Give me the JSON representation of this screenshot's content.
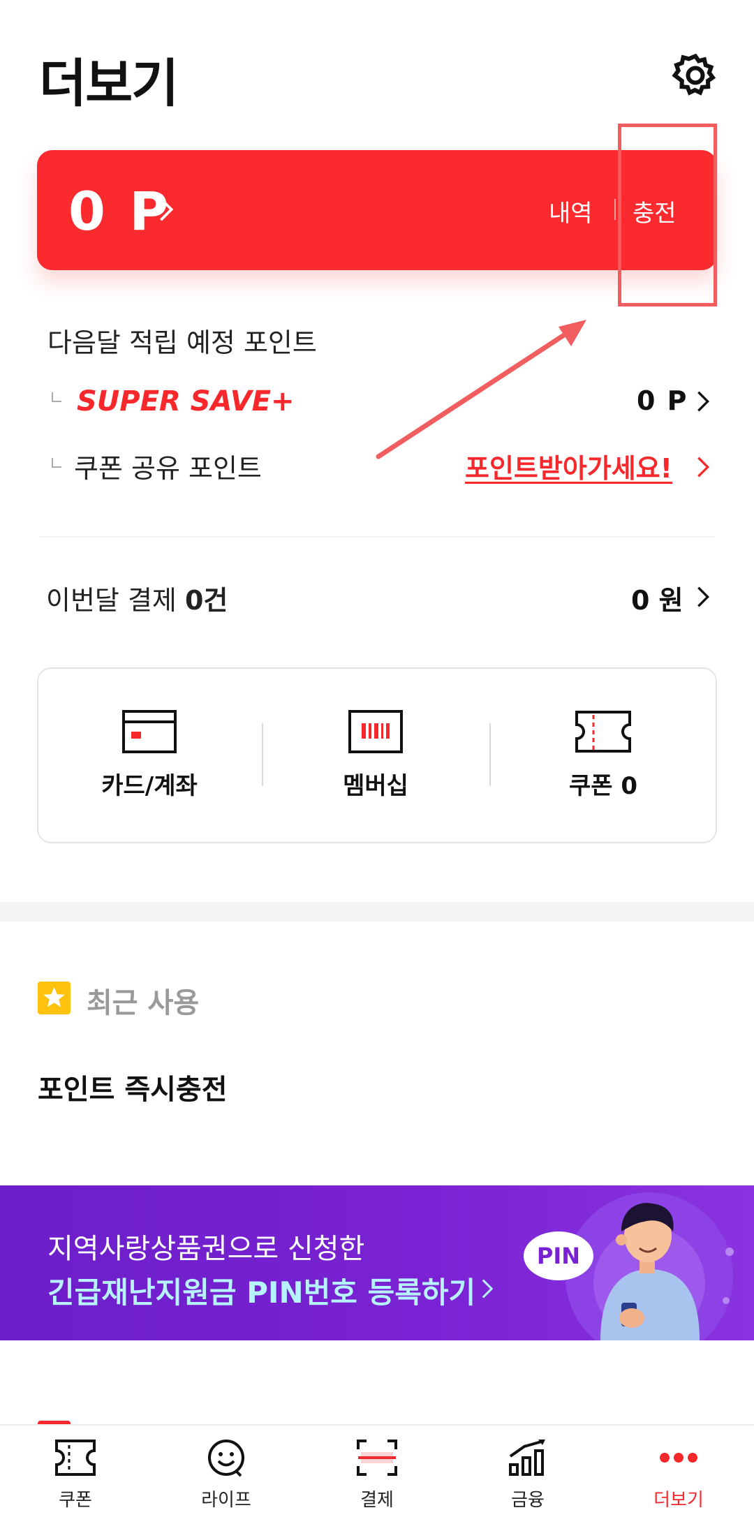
{
  "header": {
    "title": "더보기",
    "settings_icon": "gear-icon"
  },
  "points_card": {
    "value": "0 P",
    "history_label": "내역",
    "charge_label": "충전",
    "background": "#fb2a2e"
  },
  "next_month": {
    "title": "다음달 적립 예정 포인트",
    "super_save_label": "SUPER SAVE+",
    "super_save_value": "0 P",
    "coupon_share_label": "쿠폰 공유 포인트",
    "coupon_share_link": "포인트받아가세요!"
  },
  "this_month": {
    "label": "이번달 결제",
    "count": "0건",
    "amount": "0 원"
  },
  "quick_menu": [
    {
      "label": "카드/계좌",
      "icon": "card-icon"
    },
    {
      "label": "멤버십",
      "icon": "barcode-icon"
    },
    {
      "label": "쿠폰 0",
      "icon": "ticket-icon"
    }
  ],
  "recent": {
    "title": "최근 사용",
    "item": "포인트 즉시충전",
    "icon": "star-icon"
  },
  "banner": {
    "line1": "지역사랑상품권으로 신청한",
    "line2": "긴급재난지원금 PIN번호 등록하기",
    "bubble": "PIN"
  },
  "bottom_nav": [
    {
      "label": "쿠폰",
      "icon": "coupon-icon",
      "active": false
    },
    {
      "label": "라이프",
      "icon": "smile-icon",
      "active": false
    },
    {
      "label": "결제",
      "icon": "scan-icon",
      "active": false
    },
    {
      "label": "금융",
      "icon": "chart-icon",
      "active": false
    },
    {
      "label": "더보기",
      "icon": "more-icon",
      "active": true
    }
  ],
  "colors": {
    "accent": "#f7282c",
    "banner": "#7a22d3",
    "star": "#ffc30f"
  }
}
